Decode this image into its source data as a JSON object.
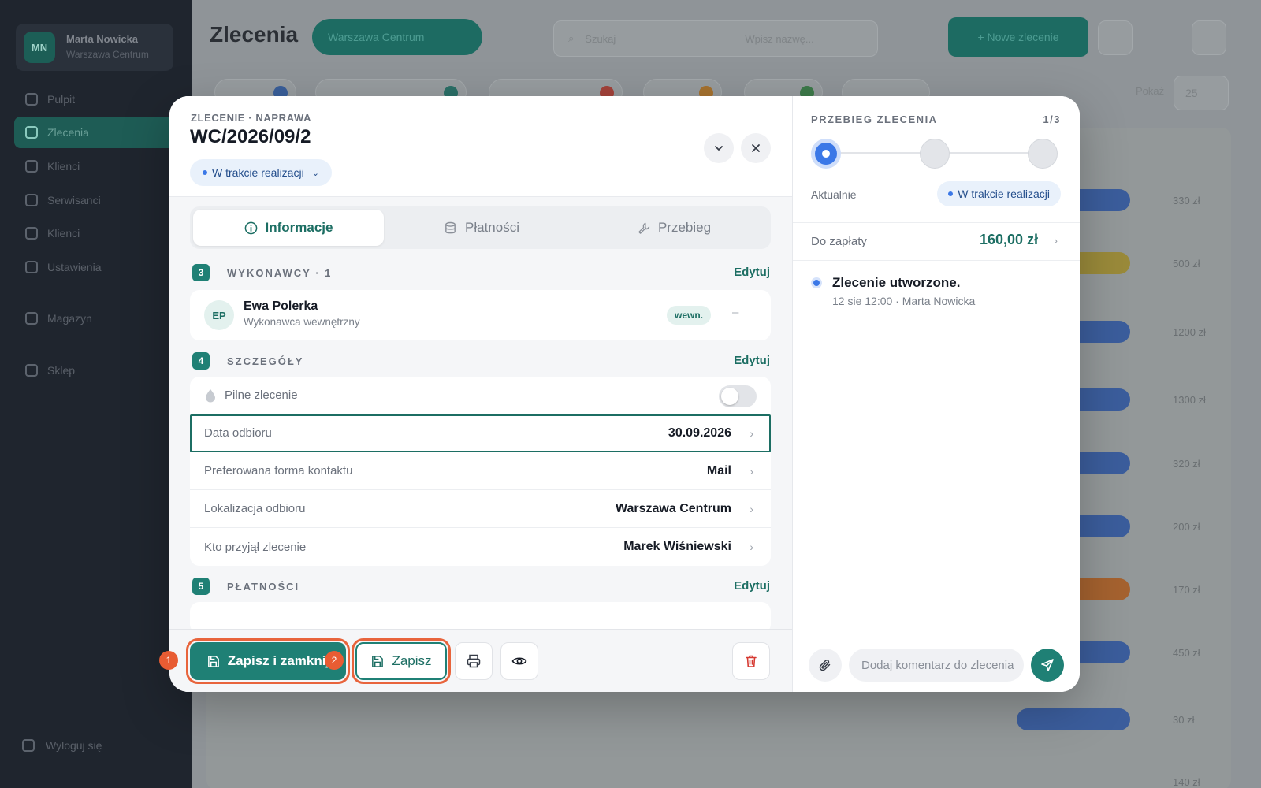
{
  "background": {
    "user": {
      "initials": "MN",
      "name": "Marta Nowicka",
      "role": "Warszawa Centrum"
    },
    "nav": [
      "Pulpit",
      "Zlecenia",
      "Klienci",
      "Serwisanci",
      "Klienci",
      "Ustawienia",
      "Magazyn",
      "Sklep"
    ],
    "nav_bottom": "Wyloguj się",
    "page_title": "Zlecenia",
    "location": "Warszawa Centrum",
    "search_placeholder": "Szukaj",
    "search_hint": "Wpisz nazwę...",
    "new_order": "+ Nowe zlecenie",
    "per_page_label": "Pokaż",
    "per_page_value": "25",
    "prices": [
      "330 zł",
      "500 zł",
      "1200 zł",
      "1300 zł",
      "320 zł",
      "200 zł",
      "170 zł",
      "450 zł",
      "30 zł",
      "140 zł"
    ]
  },
  "modal": {
    "breadcrumb": "ZLECENIE · NAPRAWA",
    "order_number": "WC/2026/09/2",
    "status": "W trakcie realizacji",
    "tabs": [
      {
        "label": "Informacje",
        "icon": "info-icon"
      },
      {
        "label": "Płatności",
        "icon": "database-icon"
      },
      {
        "label": "Przebieg",
        "icon": "wrench-icon"
      }
    ],
    "sections": {
      "contractors": {
        "num": "3",
        "title": "WYKONAWCY · 1",
        "edit": "Edytuj"
      },
      "details": {
        "num": "4",
        "title": "SZCZEGÓŁY",
        "edit": "Edytuj"
      },
      "payments": {
        "num": "5",
        "title": "PŁATNOŚCI",
        "edit": "Edytuj"
      }
    },
    "contractor": {
      "initials": "EP",
      "name": "Ewa Polerka",
      "role": "Wykonawca wewnętrzny",
      "tag": "wewn.",
      "action": "–"
    },
    "details": {
      "urgent_label": "Pilne zlecenie",
      "urgent_on": false,
      "rows": [
        {
          "label": "Data odbioru",
          "value": "30.09.2026"
        },
        {
          "label": "Preferowana forma kontaktu",
          "value": "Mail"
        },
        {
          "label": "Lokalizacja odbioru",
          "value": "Warszawa Centrum"
        },
        {
          "label": "Kto przyjął zlecenie",
          "value": "Marek Wiśniewski"
        }
      ]
    },
    "footer": {
      "save_close": "Zapisz i zamknij",
      "save": "Zapisz",
      "badge1": "1",
      "badge2": "2"
    },
    "progress": {
      "title": "PRZEBIEG ZLECENIA",
      "count": "1/3",
      "current_step": 1,
      "total_steps": 3,
      "now_label": "Aktualnie",
      "now_status": "W trakcie realizacji",
      "pay_label": "Do zapłaty",
      "pay_value": "160,00 zł",
      "timeline": [
        {
          "title": "Zlecenie utworzone.",
          "meta": "12 sie 12:00 · Marta Nowicka"
        }
      ],
      "comment_placeholder": "Dodaj komentarz do zlecenia"
    }
  },
  "colors": {
    "accent": "#1f8075",
    "status_blue": "#3b78e7",
    "highlight": "#e8643c"
  }
}
